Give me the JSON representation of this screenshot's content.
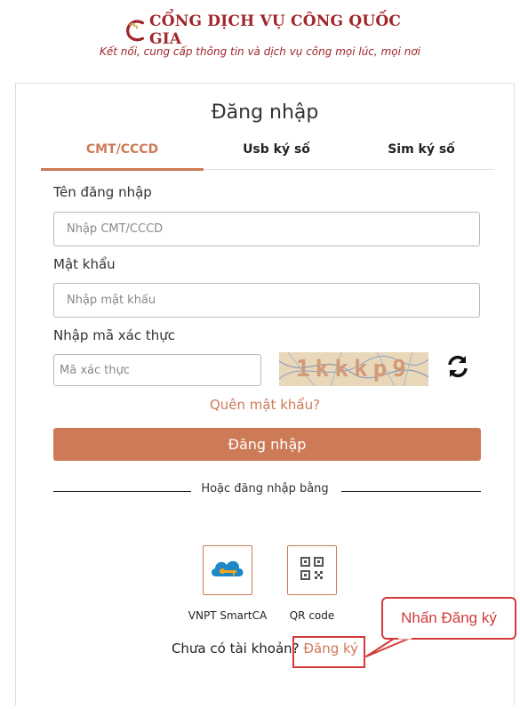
{
  "brand": {
    "title": "CỔNG DỊCH VỤ CÔNG QUỐC GIA",
    "tagline": "Kết nối, cung cấp thông tin và dịch vụ công mọi lúc, mọi nơi"
  },
  "login": {
    "title": "Đăng nhập",
    "tabs": [
      {
        "label": "CMT/CCCD",
        "active": true
      },
      {
        "label": "Usb ký số",
        "active": false
      },
      {
        "label": "Sim ký số",
        "active": false
      }
    ],
    "username": {
      "label": "Tên đăng nhập",
      "placeholder": "Nhập CMT/CCCD",
      "value": ""
    },
    "password": {
      "label": "Mật khẩu",
      "placeholder": "Nhập mật khẩu",
      "value": ""
    },
    "captcha": {
      "label": "Nhập mã xác thực",
      "placeholder": "Mã xác thực",
      "value": "",
      "code": "1kkkp9"
    },
    "forgot_label": "Quên mật khẩu?",
    "submit_label": "Đăng nhập",
    "alt_divider": "Hoặc đăng nhập bằng",
    "alt_methods": [
      {
        "label": "VNPT SmartCA",
        "icon": "vnpt-smartca-icon"
      },
      {
        "label": "QR code",
        "icon": "qr-code-icon"
      }
    ],
    "signup_prompt": "Chưa có tài khoản?",
    "signup_label": "Đăng ký"
  },
  "annotation": {
    "callout_text": "Nhấn Đăng ký"
  },
  "colors": {
    "accent": "#cd7a57",
    "brand_red": "#a0262a",
    "annotation_red": "#d23a3a"
  }
}
